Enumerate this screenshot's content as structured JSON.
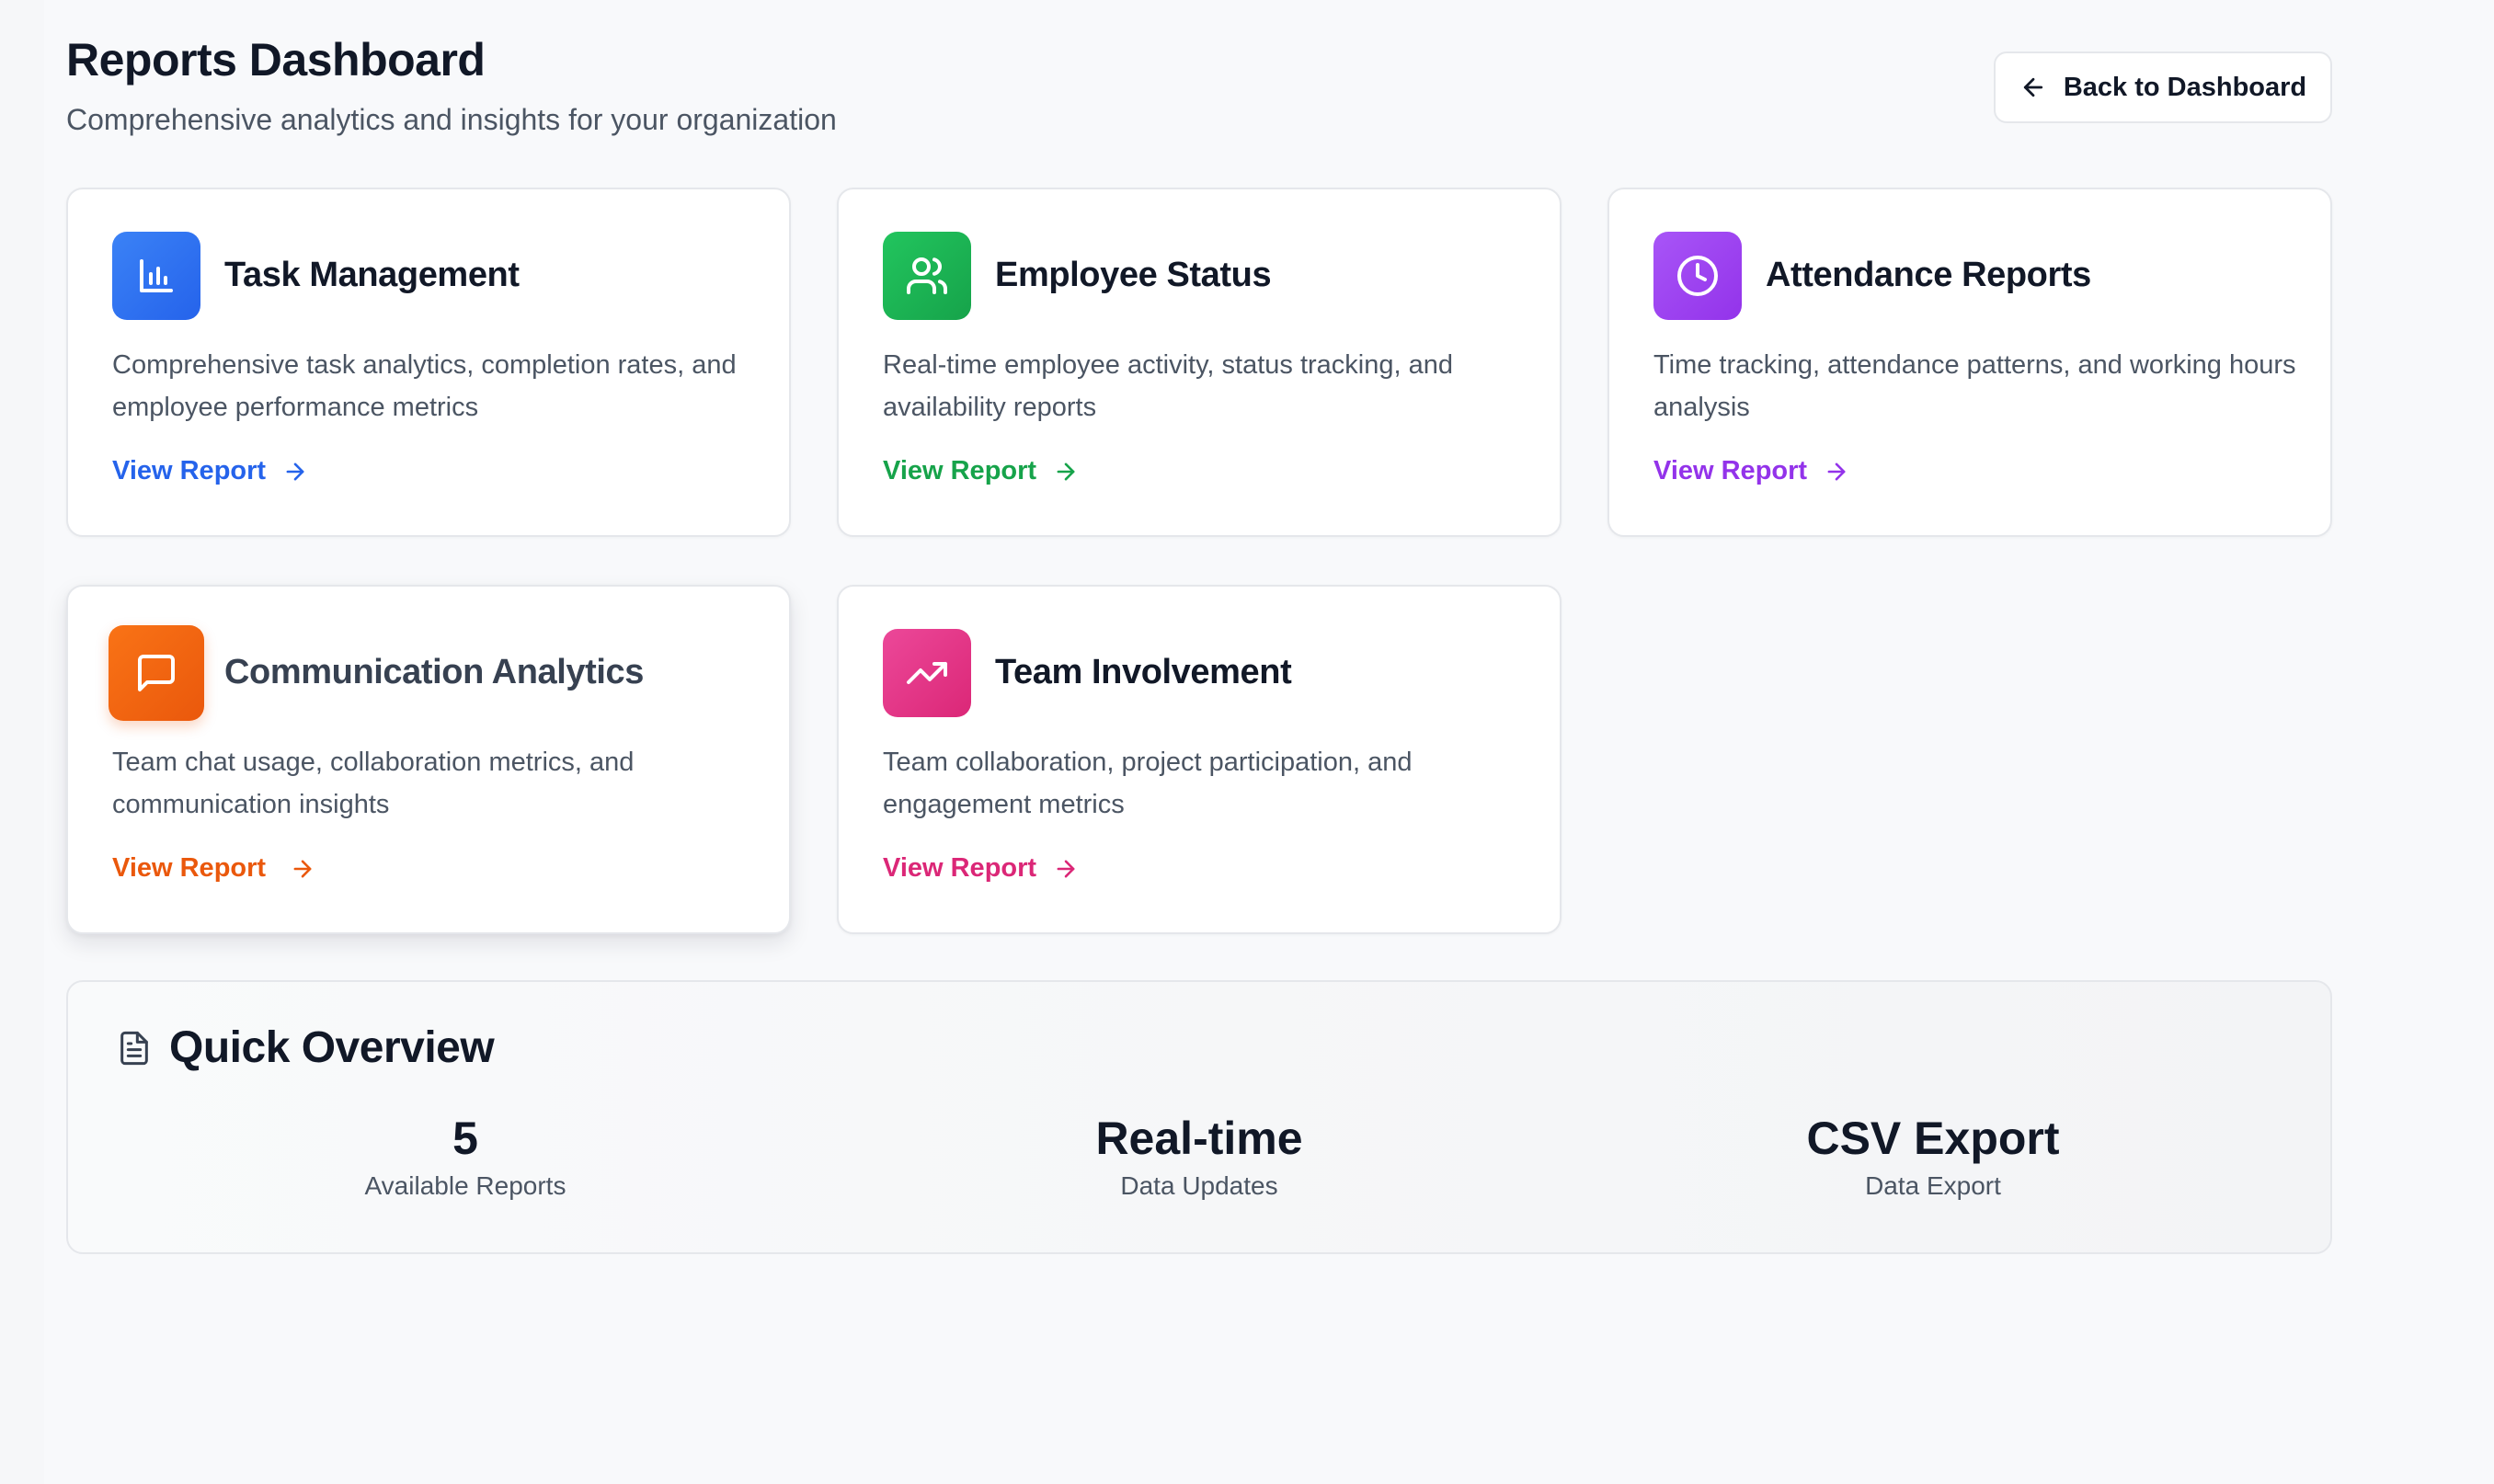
{
  "header": {
    "title": "Reports Dashboard",
    "subtitle": "Comprehensive analytics and insights for your organization",
    "back_label": "Back to Dashboard"
  },
  "cards": [
    {
      "title": "Task Management",
      "description": "Comprehensive task analytics, completion rates, and employee performance metrics",
      "link_label": "View Report",
      "icon": "bar-chart-icon",
      "color": "#2563eb"
    },
    {
      "title": "Employee Status",
      "description": "Real-time employee activity, status tracking, and availability reports",
      "link_label": "View Report",
      "icon": "users-icon",
      "color": "#16a34a"
    },
    {
      "title": "Attendance Reports",
      "description": "Time tracking, attendance patterns, and working hours analysis",
      "link_label": "View Report",
      "icon": "clock-icon",
      "color": "#9333ea"
    },
    {
      "title": "Communication Analytics",
      "description": "Team chat usage, collaboration metrics, and communication insights",
      "link_label": "View Report",
      "icon": "message-square-icon",
      "color": "#ea580c"
    },
    {
      "title": "Team Involvement",
      "description": "Team collaboration, project participation, and engagement metrics",
      "link_label": "View Report",
      "icon": "trending-up-icon",
      "color": "#db2777"
    }
  ],
  "overview": {
    "title": "Quick Overview",
    "icon": "file-text-icon",
    "stats": [
      {
        "value": "5",
        "label": "Available Reports"
      },
      {
        "value": "Real-time",
        "label": "Data Updates"
      },
      {
        "value": "CSV Export",
        "label": "Data Export"
      }
    ]
  }
}
